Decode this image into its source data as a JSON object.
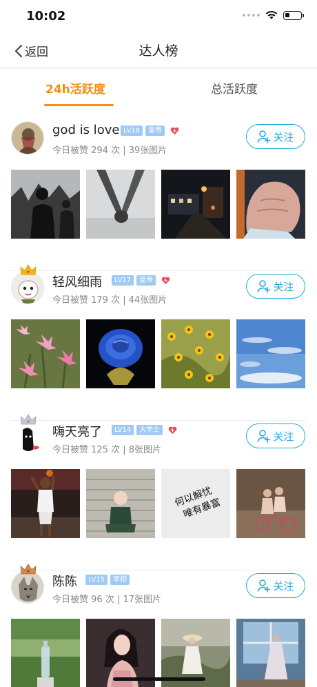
{
  "status_bar": {
    "time": "10:02"
  },
  "nav": {
    "back_label": "返回",
    "title": "达人榜"
  },
  "tabs": [
    {
      "label": "24h活跃度",
      "active": true
    },
    {
      "label": "总活跃度",
      "active": false
    }
  ],
  "accent_color": "#f29018",
  "follow_color": "#22aadd",
  "users": [
    {
      "name": "god is love",
      "level": "LV18",
      "title": "皇帝",
      "stats": "今日被赞 294 次 | 39张图片",
      "follow_label": "关注",
      "crown": false,
      "photos": [
        "silhouettes-photo",
        "holding-hands-photo",
        "night-street-photo",
        "fist-photo"
      ]
    },
    {
      "name": "轻风细雨",
      "level": "LV17",
      "title": "皇帝",
      "stats": "今日被赞 179 次 | 44张图片",
      "follow_label": "关注",
      "crown": "gold",
      "photos": [
        "pink-lilies-photo",
        "blue-rose-photo",
        "yellow-flowers-photo",
        "blue-sky-photo"
      ]
    },
    {
      "name": "嗨天亮了",
      "level": "LV14",
      "title": "大学士",
      "stats": "今日被赞 125 次 | 8张图片",
      "follow_label": "关注",
      "crown": "silver",
      "photos": [
        "basketball-player-photo",
        "child-on-steps-photo",
        "calligraphy-photo",
        "couple-cycling-photo"
      ]
    },
    {
      "name": "陈陈",
      "level": "LV15",
      "title": "宰相",
      "stats": "今日被赞 96 次 | 17张图片",
      "follow_label": "关注",
      "crown": "bronze",
      "photos": [
        "garden-bottle-photo",
        "woman-portrait-photo",
        "woman-hat-photo",
        "woman-window-photo"
      ]
    }
  ],
  "photo_texts": {
    "calligraphy": "何以解忧 唯有暴富"
  }
}
